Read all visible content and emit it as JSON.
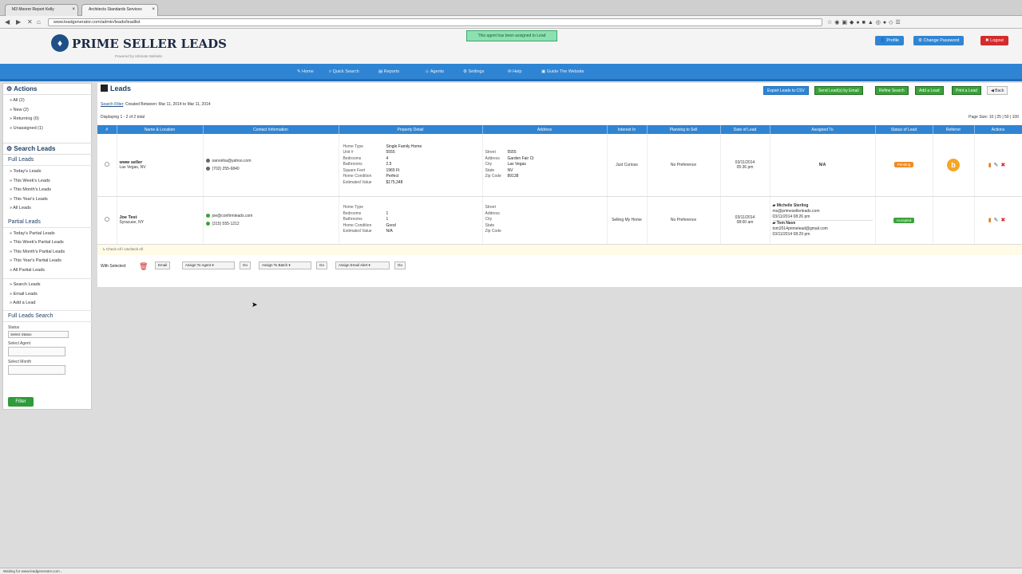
{
  "browser": {
    "tabs": [
      {
        "label": "M3 Moorer Report Kelly"
      },
      {
        "label": "Architects Standards Services"
      }
    ],
    "url": "www.leadgenerator.com/admin/leads/leadlist",
    "status": "Waiting for www.leadgenerator.com..."
  },
  "header": {
    "logo_text": "PRIME SELLER LEADS",
    "logo_sub": "Powered by Ultimate Website",
    "notice": "This agent has been assigned to Lead",
    "buttons": {
      "profile": "Profile",
      "change_password": "Change Password",
      "logout": "Logout"
    }
  },
  "nav": [
    "Home",
    "Quick Search",
    "Reports",
    "Agents",
    "Settings",
    "Help",
    "Guide The Website"
  ],
  "sidebar": {
    "actions_title": "Actions",
    "actions": [
      "All (2)",
      "New (2)",
      "Returning (0)",
      "Unassigned (1)"
    ],
    "search_title": "Search Leads",
    "full_title": "Full Leads",
    "full_items": [
      "Today's Leads",
      "This Week's Leads",
      "This Month's Leads",
      "This Year's Leads",
      "All Leads"
    ],
    "partial_title": "Partial Leads",
    "partial_items": [
      "Today's Partial Leads",
      "This Week's Partial Leads",
      "This Month's Partial Leads",
      "This Year's Partial Leads",
      "All Partial Leads"
    ],
    "other_items": [
      "Search Leads",
      "Email Leads",
      "Add a Lead"
    ],
    "fls_title": "Full Leads Search",
    "status_label": "Status",
    "status_value": "Select Status",
    "agent_label": "Select Agent",
    "month_label": "Select Month",
    "filter_label": "Filter"
  },
  "content": {
    "title": "Leads",
    "action_buttons": [
      "Export Leads to CSV",
      "Send Lead(s) by Email",
      "Refine Search",
      "Add a Lead",
      "Print a Lead",
      "Back"
    ],
    "search_filter_label": "Search Filter",
    "search_filter_text": ": Created Between: Mar 11, 2014 to Mar 11, 2014",
    "displaying": "Displaying 1 - 2 of 2 total",
    "page_size": "Page Size: 10 | 25 | 50 | 100",
    "columns": [
      "#",
      "Name & Location",
      "Contact Information",
      "Property Detail",
      "Address",
      "Interest In",
      "Planning to Sell",
      "Date of Lead",
      "Assigned To",
      "Status of Lead",
      "Referrer",
      "Actions"
    ],
    "rows": [
      {
        "name": "www seller",
        "location": "Las Vegas, NV",
        "email": "oanonha@yahoo.com",
        "phone": "(702) 255-6840",
        "property": [
          {
            "k": "Home Type",
            "v": "Single Family Home"
          },
          {
            "k": "Unit #",
            "v": "5555"
          },
          {
            "k": "Bedrooms",
            "v": "4"
          },
          {
            "k": "Bathrooms",
            "v": "2.5"
          },
          {
            "k": "Square Feet",
            "v": "1965 Ft"
          },
          {
            "k": "Home Condition",
            "v": "Perfect"
          },
          {
            "k": "Estimated Value",
            "v": "$175,348"
          }
        ],
        "address": [
          {
            "k": "Street",
            "v": "5555"
          },
          {
            "k": "Address",
            "v": "Garden Fair Ct"
          },
          {
            "k": "City",
            "v": "Las Vegas"
          },
          {
            "k": "State",
            "v": "NV"
          },
          {
            "k": "Zip Code",
            "v": "89138"
          }
        ],
        "interest": "Just Curious",
        "planning": "No Preference",
        "date": "03/11/2014",
        "time": "05:36 pm",
        "assigned": "N/A",
        "status": "Pending",
        "status_color": "#f08a24",
        "referrer": "b"
      },
      {
        "name": "Joe Test",
        "location": "Syracuse, NY",
        "email": "joe@confirmleads.com",
        "phone": "(315) 555-1212",
        "property": [
          {
            "k": "Home Type",
            "v": ""
          },
          {
            "k": "Bedrooms",
            "v": "1"
          },
          {
            "k": "Bathrooms",
            "v": "1"
          },
          {
            "k": "Home Condition",
            "v": "Good"
          },
          {
            "k": "Estimated Value",
            "v": "N/A"
          }
        ],
        "address": [
          {
            "k": "Street",
            "v": ""
          },
          {
            "k": "Address",
            "v": ""
          },
          {
            "k": "City",
            "v": ""
          },
          {
            "k": "State",
            "v": ""
          },
          {
            "k": "Zip Code",
            "v": ""
          }
        ],
        "interest": "Selling My Home",
        "planning": "No Preference",
        "date": "03/11/2014",
        "time": "08:00 am",
        "assigned1_name": "Michelle Sterling",
        "assigned1_email": "ms@primesellerleads.com",
        "assigned1_date": "03/11/2014 08:26 pm",
        "assigned2_name": "Tom Nave",
        "assigned2_email": "tom2014primelead@gmail.com",
        "assigned2_date": "03/11/2014 08:29 pm",
        "status": "Accepted",
        "status_color": "#3aa23a"
      }
    ],
    "footer_row": "Check All / Uncheck All",
    "bulk": {
      "label": "With Selected:",
      "email": "Email",
      "assign_agent": "Assign To Agent",
      "assign_batch": "Assign To Batch",
      "assign_email": "Assign Email Alert",
      "go": "Go"
    }
  }
}
